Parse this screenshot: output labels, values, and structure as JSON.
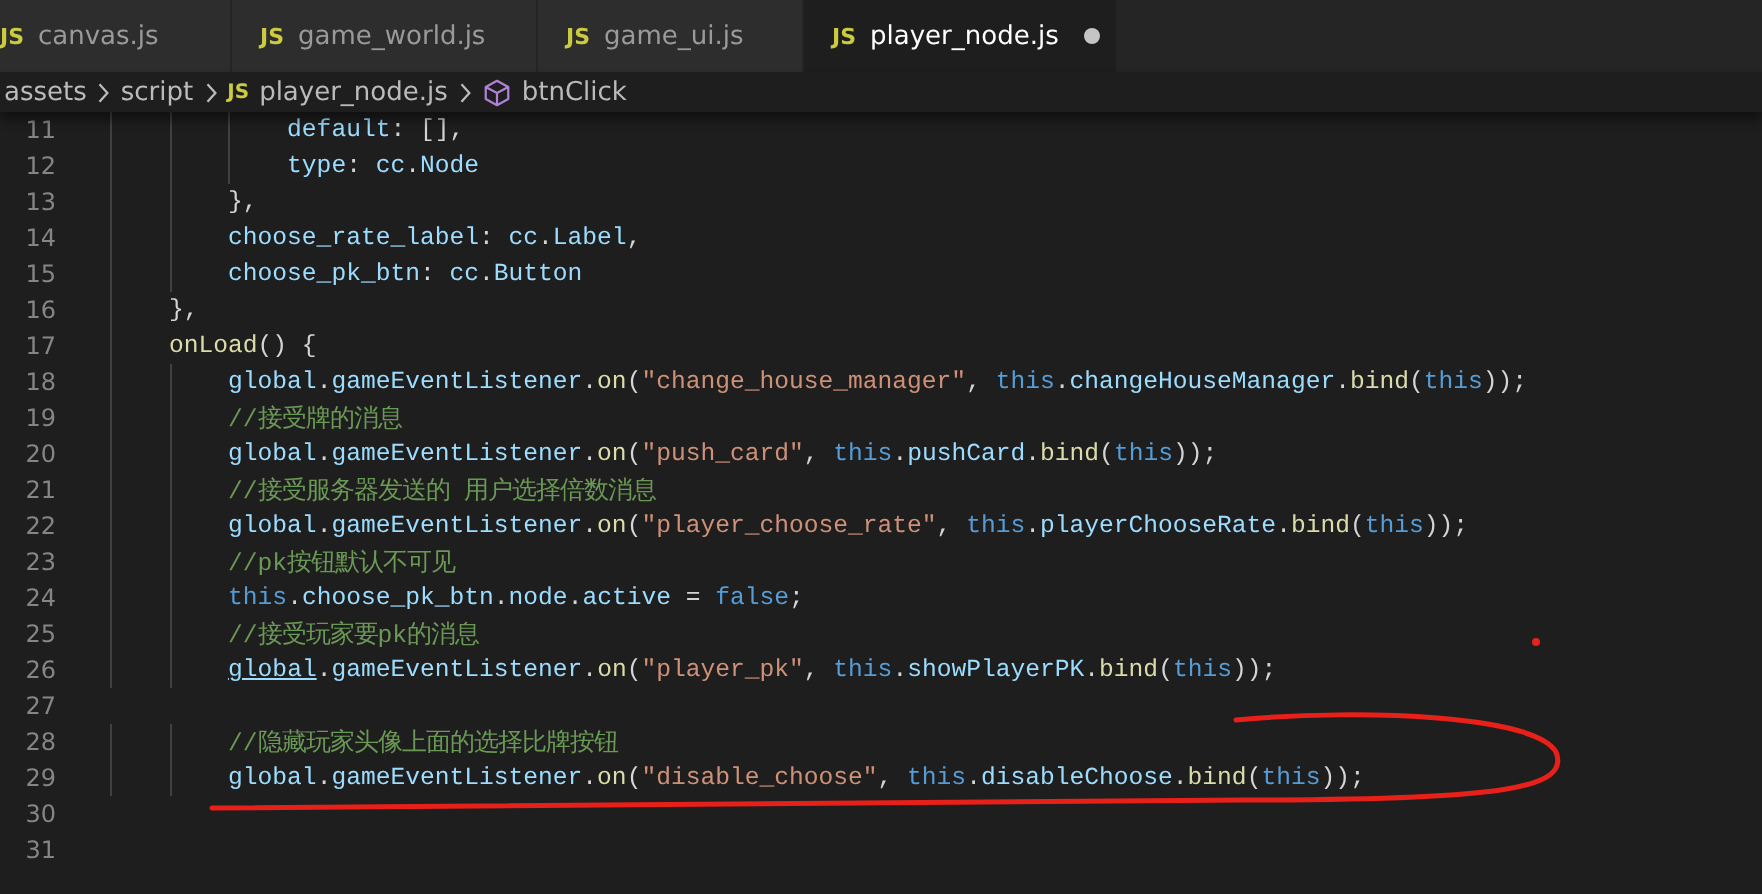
{
  "tabs": [
    {
      "badge": "JS",
      "label": "canvas.js",
      "selected": false,
      "modified": false
    },
    {
      "badge": "JS",
      "label": "game_world.js",
      "selected": false,
      "modified": false
    },
    {
      "badge": "JS",
      "label": "game_ui.js",
      "selected": false,
      "modified": false
    },
    {
      "badge": "JS",
      "label": "player_node.js",
      "selected": true,
      "modified": true
    }
  ],
  "breadcrumb": [
    {
      "kind": "folder",
      "label": "assets"
    },
    {
      "kind": "folder",
      "label": "script"
    },
    {
      "kind": "file",
      "badge": "JS",
      "label": "player_node.js"
    },
    {
      "kind": "symbol",
      "label": "btnClick"
    }
  ],
  "lines": [
    {
      "number": "11",
      "tokens": [
        {
          "text": "            default",
          "kind": "prop"
        },
        {
          "text": ": [],",
          "kind": "punc"
        }
      ]
    },
    {
      "number": "12",
      "tokens": [
        {
          "text": "            type",
          "kind": "prop"
        },
        {
          "text": ": ",
          "kind": "punc"
        },
        {
          "text": "cc",
          "kind": "prop"
        },
        {
          "text": ".",
          "kind": "punc"
        },
        {
          "text": "Node",
          "kind": "prop"
        }
      ]
    },
    {
      "number": "13",
      "tokens": [
        {
          "text": "        },",
          "kind": "punc"
        }
      ]
    },
    {
      "number": "14",
      "tokens": [
        {
          "text": "        choose_rate_label",
          "kind": "prop"
        },
        {
          "text": ": ",
          "kind": "punc"
        },
        {
          "text": "cc",
          "kind": "prop"
        },
        {
          "text": ".",
          "kind": "punc"
        },
        {
          "text": "Label",
          "kind": "prop"
        },
        {
          "text": ",",
          "kind": "punc"
        }
      ]
    },
    {
      "number": "15",
      "tokens": [
        {
          "text": "        choose_pk_btn",
          "kind": "prop"
        },
        {
          "text": ": ",
          "kind": "punc"
        },
        {
          "text": "cc",
          "kind": "prop"
        },
        {
          "text": ".",
          "kind": "punc"
        },
        {
          "text": "Button",
          "kind": "prop"
        }
      ]
    },
    {
      "number": "16",
      "tokens": [
        {
          "text": "    },",
          "kind": "punc"
        }
      ]
    },
    {
      "number": "17",
      "tokens": [
        {
          "text": "    onLoad",
          "kind": "func"
        },
        {
          "text": "() {",
          "kind": "punc"
        }
      ]
    },
    {
      "number": "18",
      "tokens": [
        {
          "text": "        global",
          "kind": "prop"
        },
        {
          "text": ".",
          "kind": "punc"
        },
        {
          "text": "gameEventListener",
          "kind": "prop"
        },
        {
          "text": ".",
          "kind": "punc"
        },
        {
          "text": "on",
          "kind": "func"
        },
        {
          "text": "(",
          "kind": "punc"
        },
        {
          "text": "\"change_house_manager\"",
          "kind": "str"
        },
        {
          "text": ", ",
          "kind": "punc"
        },
        {
          "text": "this",
          "kind": "kw"
        },
        {
          "text": ".",
          "kind": "punc"
        },
        {
          "text": "changeHouseManager",
          "kind": "prop"
        },
        {
          "text": ".",
          "kind": "punc"
        },
        {
          "text": "bind",
          "kind": "func"
        },
        {
          "text": "(",
          "kind": "punc"
        },
        {
          "text": "this",
          "kind": "kw"
        },
        {
          "text": "));",
          "kind": "punc"
        }
      ]
    },
    {
      "number": "19",
      "tokens": [
        {
          "text": "        //接受牌的消息",
          "kind": "comment"
        }
      ]
    },
    {
      "number": "20",
      "tokens": [
        {
          "text": "        global",
          "kind": "prop"
        },
        {
          "text": ".",
          "kind": "punc"
        },
        {
          "text": "gameEventListener",
          "kind": "prop"
        },
        {
          "text": ".",
          "kind": "punc"
        },
        {
          "text": "on",
          "kind": "func"
        },
        {
          "text": "(",
          "kind": "punc"
        },
        {
          "text": "\"push_card\"",
          "kind": "str"
        },
        {
          "text": ", ",
          "kind": "punc"
        },
        {
          "text": "this",
          "kind": "kw"
        },
        {
          "text": ".",
          "kind": "punc"
        },
        {
          "text": "pushCard",
          "kind": "prop"
        },
        {
          "text": ".",
          "kind": "punc"
        },
        {
          "text": "bind",
          "kind": "func"
        },
        {
          "text": "(",
          "kind": "punc"
        },
        {
          "text": "this",
          "kind": "kw"
        },
        {
          "text": "));",
          "kind": "punc"
        }
      ]
    },
    {
      "number": "21",
      "tokens": [
        {
          "text": "        //接受服务器发送的 用户选择倍数消息",
          "kind": "comment"
        }
      ]
    },
    {
      "number": "22",
      "tokens": [
        {
          "text": "        global",
          "kind": "prop"
        },
        {
          "text": ".",
          "kind": "punc"
        },
        {
          "text": "gameEventListener",
          "kind": "prop"
        },
        {
          "text": ".",
          "kind": "punc"
        },
        {
          "text": "on",
          "kind": "func"
        },
        {
          "text": "(",
          "kind": "punc"
        },
        {
          "text": "\"player_choose_rate\"",
          "kind": "str"
        },
        {
          "text": ", ",
          "kind": "punc"
        },
        {
          "text": "this",
          "kind": "kw"
        },
        {
          "text": ".",
          "kind": "punc"
        },
        {
          "text": "playerChooseRate",
          "kind": "prop"
        },
        {
          "text": ".",
          "kind": "punc"
        },
        {
          "text": "bind",
          "kind": "func"
        },
        {
          "text": "(",
          "kind": "punc"
        },
        {
          "text": "this",
          "kind": "kw"
        },
        {
          "text": "));",
          "kind": "punc"
        }
      ]
    },
    {
      "number": "23",
      "tokens": [
        {
          "text": "        //pk按钮默认不可见",
          "kind": "comment"
        }
      ]
    },
    {
      "number": "24",
      "tokens": [
        {
          "text": "        this",
          "kind": "kw"
        },
        {
          "text": ".",
          "kind": "punc"
        },
        {
          "text": "choose_pk_btn",
          "kind": "prop"
        },
        {
          "text": ".",
          "kind": "punc"
        },
        {
          "text": "node",
          "kind": "prop"
        },
        {
          "text": ".",
          "kind": "punc"
        },
        {
          "text": "active",
          "kind": "prop"
        },
        {
          "text": " = ",
          "kind": "punc"
        },
        {
          "text": "false",
          "kind": "kw"
        },
        {
          "text": ";",
          "kind": "punc"
        }
      ]
    },
    {
      "number": "25",
      "ink_dot": true,
      "tokens": [
        {
          "text": "        //接受玩家要pk的消息",
          "kind": "comment"
        }
      ]
    },
    {
      "number": "26",
      "tokens": [
        {
          "text": "        global",
          "kind": "link"
        },
        {
          "text": ".",
          "kind": "punc"
        },
        {
          "text": "gameEventListener",
          "kind": "prop"
        },
        {
          "text": ".",
          "kind": "punc"
        },
        {
          "text": "on",
          "kind": "func"
        },
        {
          "text": "(",
          "kind": "punc"
        },
        {
          "text": "\"player_pk\"",
          "kind": "str"
        },
        {
          "text": ", ",
          "kind": "punc"
        },
        {
          "text": "this",
          "kind": "kw"
        },
        {
          "text": ".",
          "kind": "punc"
        },
        {
          "text": "showPlayerPK",
          "kind": "prop"
        },
        {
          "text": ".",
          "kind": "punc"
        },
        {
          "text": "bind",
          "kind": "func"
        },
        {
          "text": "(",
          "kind": "punc"
        },
        {
          "text": "this",
          "kind": "kw"
        },
        {
          "text": "));",
          "kind": "punc"
        }
      ]
    },
    {
      "number": "27"
    },
    {
      "number": "28",
      "tokens": [
        {
          "text": "        //隐藏玩家头像上面的选择比牌按钮",
          "kind": "comment"
        }
      ]
    },
    {
      "number": "29",
      "circled": true,
      "tokens": [
        {
          "text": "        global",
          "kind": "prop"
        },
        {
          "text": ".",
          "kind": "punc"
        },
        {
          "text": "gameEventListener",
          "kind": "prop"
        },
        {
          "text": ".",
          "kind": "punc"
        },
        {
          "text": "on",
          "kind": "func"
        },
        {
          "text": "(",
          "kind": "punc"
        },
        {
          "text": "\"disable_choose\"",
          "kind": "str"
        },
        {
          "text": ", ",
          "kind": "punc"
        },
        {
          "text": "this",
          "kind": "kw"
        },
        {
          "text": ".",
          "kind": "punc"
        },
        {
          "text": "disableChoose",
          "kind": "prop"
        },
        {
          "text": ".",
          "kind": "punc"
        },
        {
          "text": "bind",
          "kind": "func"
        },
        {
          "text": "(",
          "kind": "punc"
        },
        {
          "text": "this",
          "kind": "kw"
        },
        {
          "text": "));",
          "kind": "punc"
        }
      ]
    },
    {
      "number": "30"
    },
    {
      "number": "31"
    }
  ]
}
